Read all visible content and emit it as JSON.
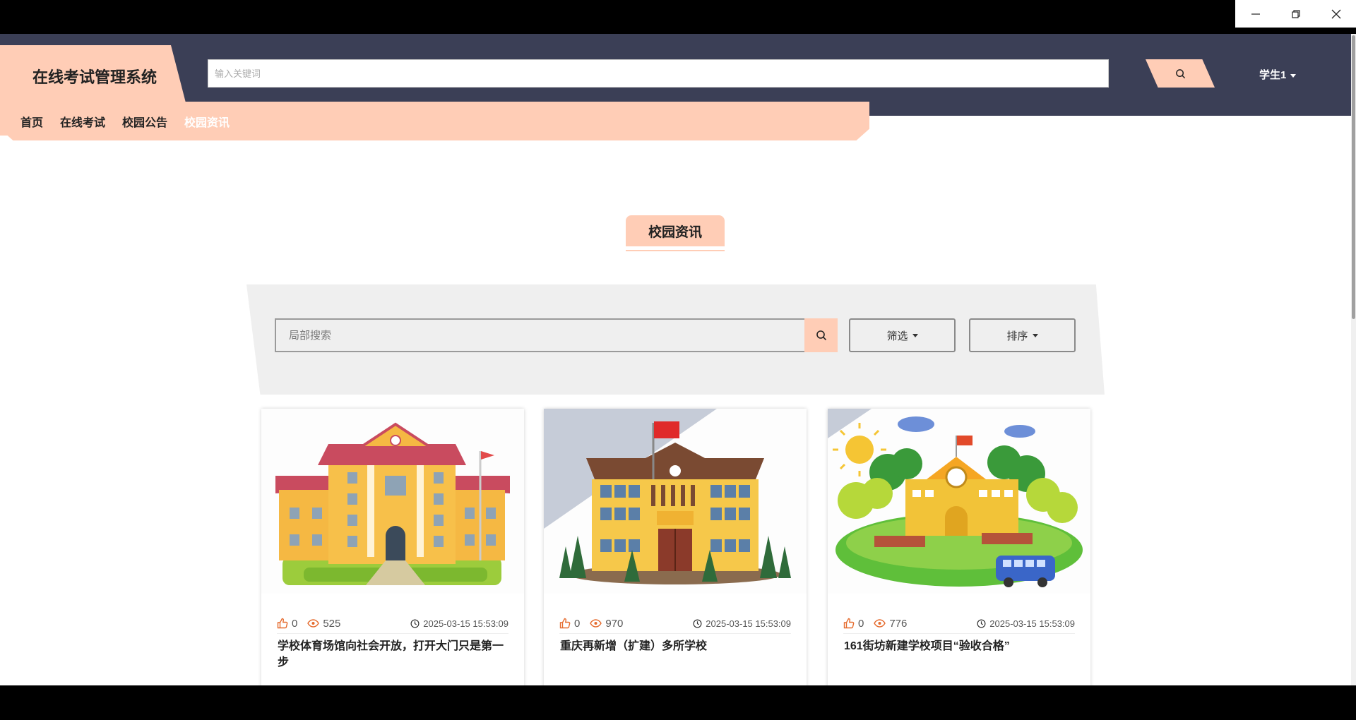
{
  "app": {
    "title": "在线考试管理系统"
  },
  "window": {
    "minimize_icon": "minimize-icon",
    "restore_icon": "restore-icon",
    "close_icon": "close-icon"
  },
  "header": {
    "search_placeholder": "输入关键词",
    "user_label": "学生1"
  },
  "nav": {
    "items": [
      "首页",
      "在线考试",
      "校园公告",
      "校园资讯"
    ],
    "active": "校园资讯"
  },
  "section": {
    "title": "校园资讯"
  },
  "filters": {
    "local_search_placeholder": "局部搜索",
    "filter_label": "筛选",
    "sort_label": "排序"
  },
  "colors": {
    "accent": "#ffcdb6",
    "header_bg": "#3b3f56",
    "icon_orange": "#e56b2e"
  },
  "cards": [
    {
      "likes": "0",
      "views": "525",
      "date": "2025-03-15 15:53:09",
      "title": "学校体育场馆向社会开放，打开大门只是第一步"
    },
    {
      "likes": "0",
      "views": "970",
      "date": "2025-03-15 15:53:09",
      "title": "重庆再新增（扩建）多所学校"
    },
    {
      "likes": "0",
      "views": "776",
      "date": "2025-03-15 15:53:09",
      "title": "161街坊新建学校项目“验收合格”"
    }
  ]
}
